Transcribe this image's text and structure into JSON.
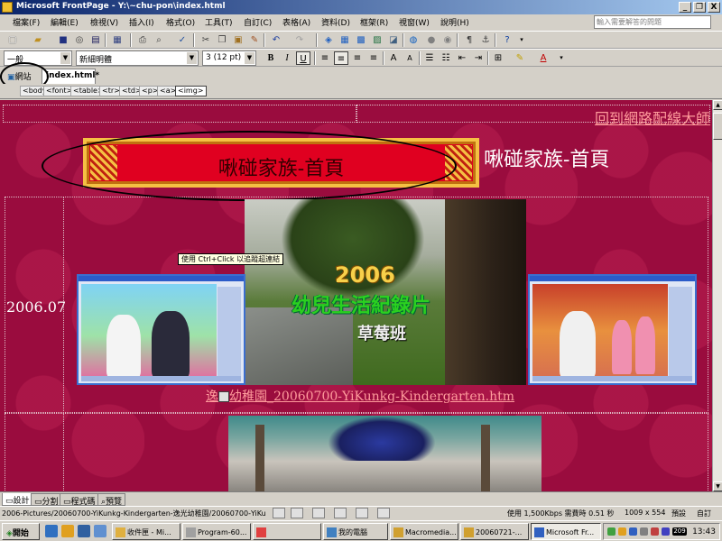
{
  "window": {
    "title": "Microsoft FrontPage - Y:\\~chu-pon\\index.html",
    "controls": [
      "_",
      "❐",
      "X"
    ]
  },
  "menu": {
    "items": [
      "檔案(F)",
      "編輯(E)",
      "檢視(V)",
      "插入(I)",
      "格式(O)",
      "工具(T)",
      "自訂(C)",
      "表格(A)",
      "資料(D)",
      "框架(R)",
      "視窗(W)",
      "說明(H)"
    ],
    "help_placeholder": "輸入需要解答的問題"
  },
  "format_toolbar": {
    "style": "一般",
    "font": "新細明體",
    "size": "3  (12 pt)",
    "bold": "B",
    "italic": "I",
    "underline": "U"
  },
  "tabs": {
    "web": "網站",
    "file": "index.html*"
  },
  "quick_tags": [
    "<body>",
    "<font>",
    "<table>",
    "<tr>",
    "<td>",
    "<p>",
    "<a>",
    "<img>"
  ],
  "page": {
    "back_link": "回到網路配線大師",
    "banner_text": "啾碰家族-首頁",
    "side_title": "啾碰家族-首頁",
    "date": "2006.07",
    "tooltip": "使用 Ctrl+Click 以追蹤超連結",
    "video_year": "2006",
    "video_subtitle": "幼兒生活紀錄片",
    "video_class": "草莓班",
    "link_prefix": "逸",
    "link_text": "幼稚園_20060700-YiKunkg-Kindergarten.htm"
  },
  "view_tabs": [
    "設計",
    "分割",
    "程式碼",
    "預覽"
  ],
  "status": {
    "path": "2006-Pictures/20060700-YiKunkg-Kindergarten-逸光幼稚園/20060700-YiKu",
    "speed": "使用 1,500Kbps 需費時 0.51 秒",
    "size": "1009 x 554",
    "mode1": "預設",
    "mode2": "自訂"
  },
  "taskbar": {
    "start": "開始",
    "tasks": [
      "收件匣 - Mi...",
      "Program-60...",
      "",
      "我的電腦",
      "Macromedia...",
      "20060721-...",
      "Microsoft Fr..."
    ],
    "clock": "13:43",
    "tray_badge": "209"
  }
}
